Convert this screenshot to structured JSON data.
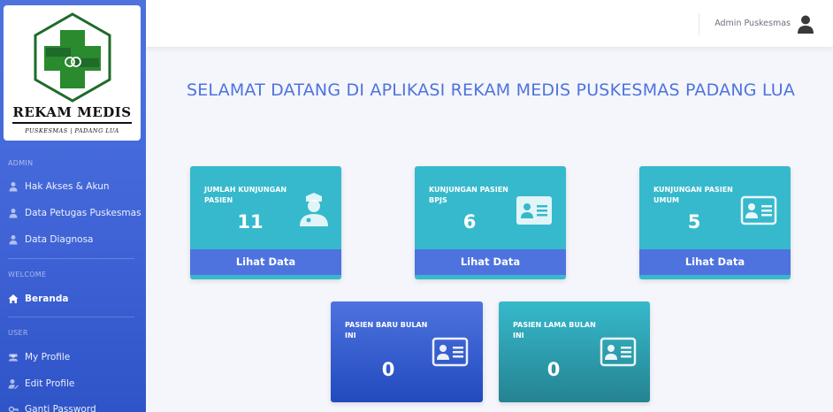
{
  "sidebar": {
    "logo": {
      "title": "REKAM MEDIS",
      "subtitle": "PUSKESMAS | PADANG LUA"
    },
    "sections": [
      {
        "heading": "ADMIN"
      },
      {
        "heading": "WELCOME"
      },
      {
        "heading": "USER"
      }
    ],
    "items": [
      {
        "label": "Hak Akses & Akun",
        "icon": "user-icon"
      },
      {
        "label": "Data Petugas Puskesmas",
        "icon": "user-icon"
      },
      {
        "label": "Data Diagnosa",
        "icon": "user-icon"
      },
      {
        "label": "Beranda",
        "icon": "home-icon"
      },
      {
        "label": "My Profile",
        "icon": "users-icon"
      },
      {
        "label": "Edit Profile",
        "icon": "user-edit-icon"
      },
      {
        "label": "Ganti Password",
        "icon": "key-icon"
      }
    ]
  },
  "topbar": {
    "user_name": "Admin Puskesmas"
  },
  "main": {
    "title": "SELAMAT DATANG DI APLIKASI REKAM MEDIS PUSKESMAS PADANG LUA",
    "cards": [
      {
        "title": "JUMLAH KUNJUNGAN PASIEN",
        "value": "11",
        "footer": "Lihat Data",
        "icon": "user-nurse-icon"
      },
      {
        "title": "KUNJUNGAN PASIEN BPJS",
        "value": "6",
        "footer": "Lihat Data",
        "icon": "id-card-icon"
      },
      {
        "title": "KUNJUNGAN PASIEN UMUM",
        "value": "5",
        "footer": "Lihat Data",
        "icon": "id-card-icon"
      },
      {
        "title": "PASIEN BARU BULAN INI",
        "value": "0",
        "icon": "id-card-icon"
      },
      {
        "title": "PASIEN LAMA BULAN INI",
        "value": "0",
        "icon": "id-card-icon"
      }
    ]
  },
  "colors": {
    "primary": "#4e73df",
    "info": "#36b9cc"
  }
}
